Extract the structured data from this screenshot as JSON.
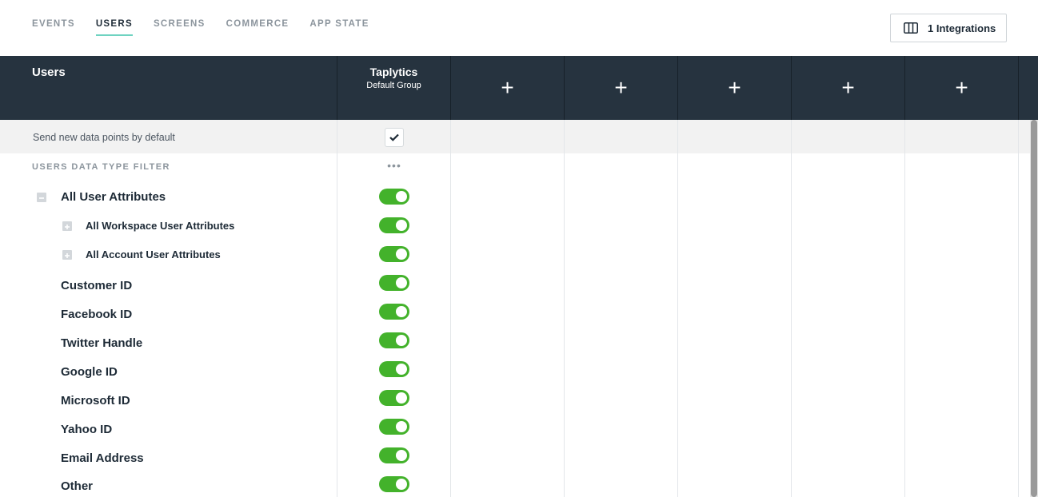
{
  "nav": {
    "tabs": [
      {
        "label": "EVENTS",
        "active": false
      },
      {
        "label": "USERS",
        "active": true
      },
      {
        "label": "SCREENS",
        "active": false
      },
      {
        "label": "COMMERCE",
        "active": false
      },
      {
        "label": "APP STATE",
        "active": false
      }
    ],
    "integrations_label": "1 Integrations",
    "integrations_icon": "columns-icon"
  },
  "header": {
    "title": "Users",
    "columns": [
      {
        "name": "Taplytics",
        "subtitle": "Default Group"
      }
    ],
    "add_columns": [
      "+",
      "+",
      "+",
      "+",
      "+"
    ]
  },
  "send_default": {
    "label": "Send new data points by default",
    "checked": true
  },
  "filter": {
    "label": "USERS DATA TYPE FILTER",
    "menu": "•••"
  },
  "attributes": [
    {
      "label": "All User Attributes",
      "level": 0,
      "expander": "collapse",
      "enabled": true
    },
    {
      "label": "All Workspace User Attributes",
      "level": 1,
      "expander": "expand",
      "enabled": true
    },
    {
      "label": "All Account User Attributes",
      "level": 1,
      "expander": "expand",
      "enabled": true
    },
    {
      "label": "Customer ID",
      "level": 0,
      "expander": "",
      "enabled": true
    },
    {
      "label": "Facebook ID",
      "level": 0,
      "expander": "",
      "enabled": true
    },
    {
      "label": "Twitter Handle",
      "level": 0,
      "expander": "",
      "enabled": true
    },
    {
      "label": "Google ID",
      "level": 0,
      "expander": "",
      "enabled": true
    },
    {
      "label": "Microsoft ID",
      "level": 0,
      "expander": "",
      "enabled": true
    },
    {
      "label": "Yahoo ID",
      "level": 0,
      "expander": "",
      "enabled": true
    },
    {
      "label": "Email Address",
      "level": 0,
      "expander": "",
      "enabled": true
    },
    {
      "label": "Other",
      "level": 0,
      "expander": "",
      "enabled": true
    }
  ],
  "colors": {
    "header_bg": "#26333f",
    "toggle_on": "#43b22b",
    "tab_underline": "#6fd3c1"
  }
}
